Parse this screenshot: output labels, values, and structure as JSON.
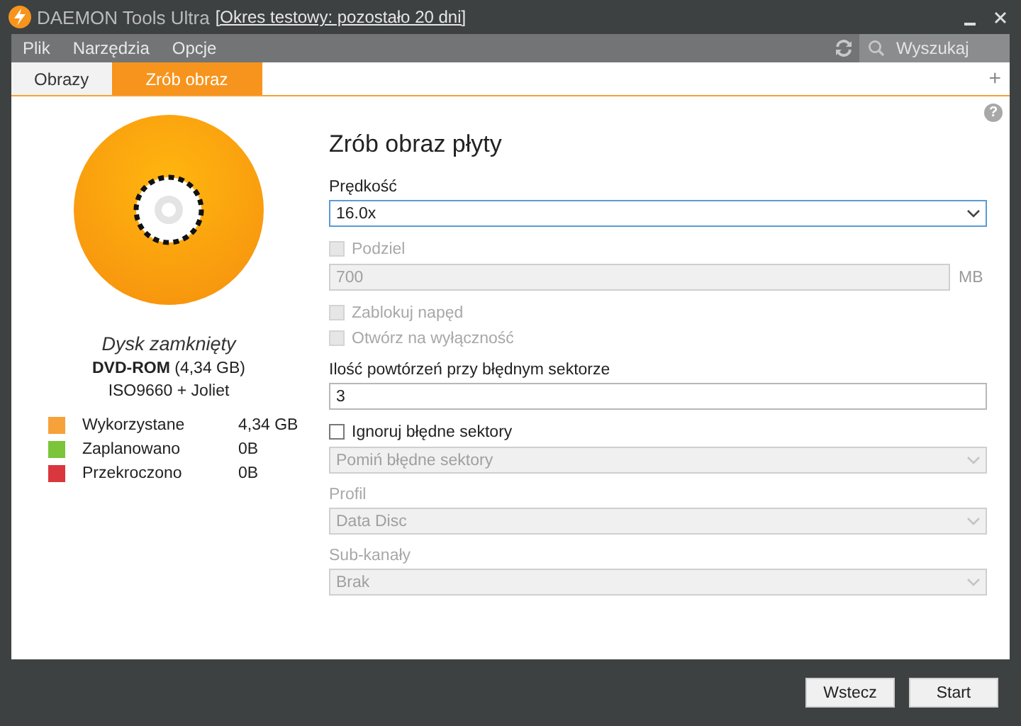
{
  "window": {
    "title": "DAEMON Tools Ultra",
    "trial_link": "[Okres testowy: pozostało 20 dni]"
  },
  "menu": [
    {
      "label": "Plik"
    },
    {
      "label": "Narzędzia"
    },
    {
      "label": "Opcje"
    }
  ],
  "search": {
    "placeholder": "Wyszukaj"
  },
  "tabs": [
    {
      "label": "Obrazy",
      "selected": false
    },
    {
      "label": "Zrób obraz",
      "selected": true
    }
  ],
  "add_tab": "+",
  "help": "?",
  "disc": {
    "status": "Dysk zamknięty",
    "type": "**DVD-ROM** (4,34 GB)",
    "filesystem": "ISO9660 + Joliet"
  },
  "legend": [
    {
      "label": "Wykorzystane",
      "value": "4,34 GB",
      "color": "#f7a13a"
    },
    {
      "label": "Zaplanowano",
      "value": "0B",
      "color": "#7cc43a"
    },
    {
      "label": "Przekroczono",
      "value": "0B",
      "color": "#d9363e"
    }
  ],
  "form": {
    "title": "Zrób obraz płyty",
    "fields": [
      {
        "kind": "select",
        "label": "Prędkość",
        "value": "16.0x",
        "disabled": false
      },
      {
        "kind": "checkbox",
        "label": "Podziel",
        "checked": false,
        "disabled": true
      },
      {
        "kind": "input",
        "value": "700",
        "unit": "MB",
        "disabled": true
      },
      {
        "kind": "checkbox",
        "label": "Zablokuj napęd",
        "checked": false,
        "disabled": true
      },
      {
        "kind": "checkbox",
        "label": "Otwórz na wyłączność",
        "checked": false,
        "disabled": true
      },
      {
        "kind": "input",
        "label": "Ilość powtórzeń przy błędnym sektorze",
        "value": "3",
        "disabled": false
      },
      {
        "kind": "checkbox",
        "label": "Ignoruj błędne sektory",
        "checked": false,
        "disabled": false
      },
      {
        "kind": "select",
        "value": "Pomiń błędne sektory",
        "disabled": true
      },
      {
        "kind": "select",
        "label": "Profil",
        "value": "Data Disc",
        "disabled": true
      },
      {
        "kind": "select",
        "label": "Sub-kanały",
        "value": "Brak",
        "disabled": true
      }
    ]
  },
  "buttons": [
    {
      "label": "Wstecz"
    },
    {
      "label": "Start"
    }
  ]
}
